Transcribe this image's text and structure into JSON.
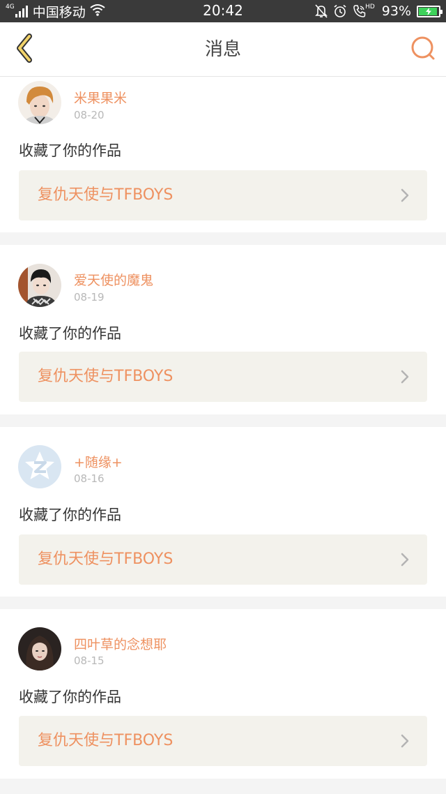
{
  "status_bar": {
    "network": "4G",
    "carrier": "中国移动",
    "time": "20:42",
    "hd": "HD",
    "battery_percent_text": "93%",
    "battery_level": 0.93,
    "icons": [
      "signal-icon",
      "wifi-icon",
      "mute-icon",
      "alarm-icon",
      "hd-call-icon",
      "battery-icon"
    ]
  },
  "header": {
    "title": "消息",
    "back_icon": "back-chevron-icon",
    "search_icon": "search-icon",
    "accent_color": "#ee9160"
  },
  "messages": [
    {
      "user": "米果果米",
      "date": "08-20",
      "action": "收藏了你的作品",
      "work": "复仇天使与TFBOYS"
    },
    {
      "user": "爱天使的魔鬼",
      "date": "08-19",
      "action": "收藏了你的作品",
      "work": "复仇天使与TFBOYS"
    },
    {
      "user": "+随缘+",
      "date": "08-16",
      "action": "收藏了你的作品",
      "work": "复仇天使与TFBOYS"
    },
    {
      "user": "四叶草的念想耶",
      "date": "08-15",
      "action": "收藏了你的作品",
      "work": "复仇天使与TFBOYS"
    }
  ]
}
